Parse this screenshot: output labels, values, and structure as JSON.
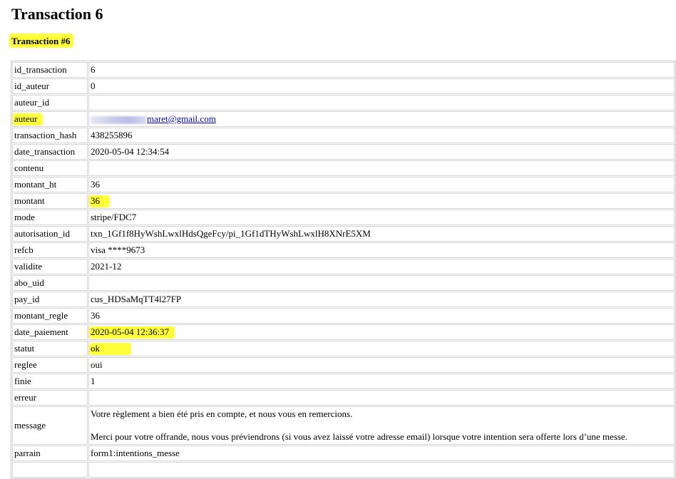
{
  "page_title": "Transaction 6",
  "section_title": "Transaction #6",
  "highlight_color": "#ffff3a",
  "rows": [
    {
      "key": "id_transaction",
      "value": "6"
    },
    {
      "key": "id_auteur",
      "value": "0"
    },
    {
      "key": "auteur_id",
      "value": ""
    },
    {
      "key": "auteur",
      "value": "maret@gmail.com"
    },
    {
      "key": "transaction_hash",
      "value": "438255896"
    },
    {
      "key": "date_transaction",
      "value": "2020-05-04 12:34:54"
    },
    {
      "key": "contenu",
      "value": ""
    },
    {
      "key": "montant_ht",
      "value": "36"
    },
    {
      "key": "montant",
      "value": "36"
    },
    {
      "key": "mode",
      "value": "stripe/FDC7"
    },
    {
      "key": "autorisation_id",
      "value": "txn_1Gf1f8HyWshLwxlHdsQgeFcy/pi_1Gf1dTHyWshLwxlH8XNrE5XM"
    },
    {
      "key": "refcb",
      "value": "visa ****9673"
    },
    {
      "key": "validite",
      "value": "2021-12"
    },
    {
      "key": "abo_uid",
      "value": ""
    },
    {
      "key": "pay_id",
      "value": "cus_HDSaMqTT4l27FP"
    },
    {
      "key": "montant_regle",
      "value": "36"
    },
    {
      "key": "date_paiement",
      "value": "2020-05-04 12:36:37"
    },
    {
      "key": "statut",
      "value": "ok"
    },
    {
      "key": "reglee",
      "value": "oui"
    },
    {
      "key": "finie",
      "value": "1"
    },
    {
      "key": "erreur",
      "value": ""
    },
    {
      "key": "message",
      "value": "Votre règlement a bien été pris en compte, et nous vous en remercions."
    },
    {
      "key": "message_line2",
      "value": "Merci pour votre offrande, nous vous préviendrons (si vous avez laissé votre adresse email) lorsque votre intention sera offerte lors d’une messe."
    },
    {
      "key": "parrain",
      "value": "form1:intentions_messe"
    }
  ]
}
